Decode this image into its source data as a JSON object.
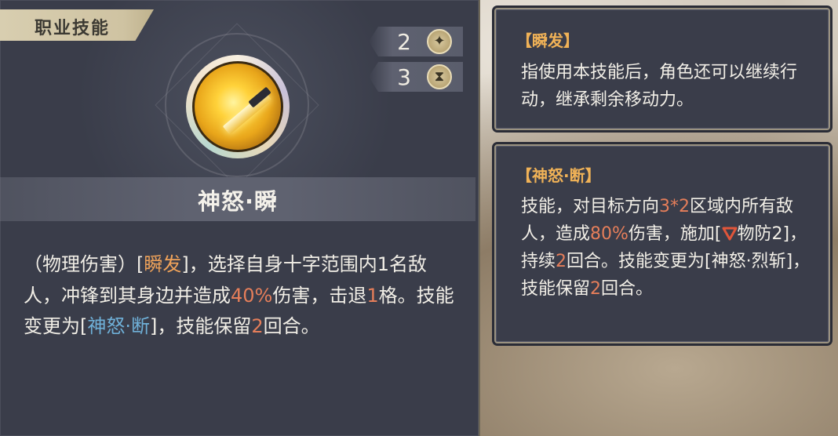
{
  "panel": {
    "tab_title": "职业技能",
    "skill_name": "神怒·瞬",
    "stats": [
      {
        "value": "2",
        "icon": "sparkle-icon",
        "glyph": "✦"
      },
      {
        "value": "3",
        "icon": "hourglass-icon",
        "glyph": "⧗"
      }
    ],
    "description": {
      "p1": "（物理伤害）[",
      "kw1": "瞬发",
      "p2": "]，选择自身十字范围内",
      "n1": "1",
      "p3": "名敌人，冲锋到其身边并造成",
      "n2": "40%",
      "p4": "伤害，击退",
      "n3": "1",
      "p5": "格。技能变更为[",
      "kw2": "神怒·断",
      "p6": "]，技能保留",
      "n4": "2",
      "p7": "回合。"
    }
  },
  "tooltips": [
    {
      "title": "【瞬发】",
      "body": "指使用本技能后，角色还可以继续行动，继承剩余移动力。"
    },
    {
      "title": "【神怒·断】",
      "b1": "技能，对目标方向",
      "n1": "3*2",
      "b2": "区域内所有敌人，造成",
      "n2": "80%",
      "b3": "伤害，施加[",
      "b4": "物防2]，持续",
      "n3": "2",
      "b5": "回合。技能变更为[神怒·烈斩]，技能保留",
      "n4": "2",
      "b6": "回合。"
    }
  ],
  "colors": {
    "keyword": "#f0a35a",
    "number": "#e57e5a",
    "skill_link": "#6fb0d8",
    "tooltip_title": "#f0b257"
  }
}
